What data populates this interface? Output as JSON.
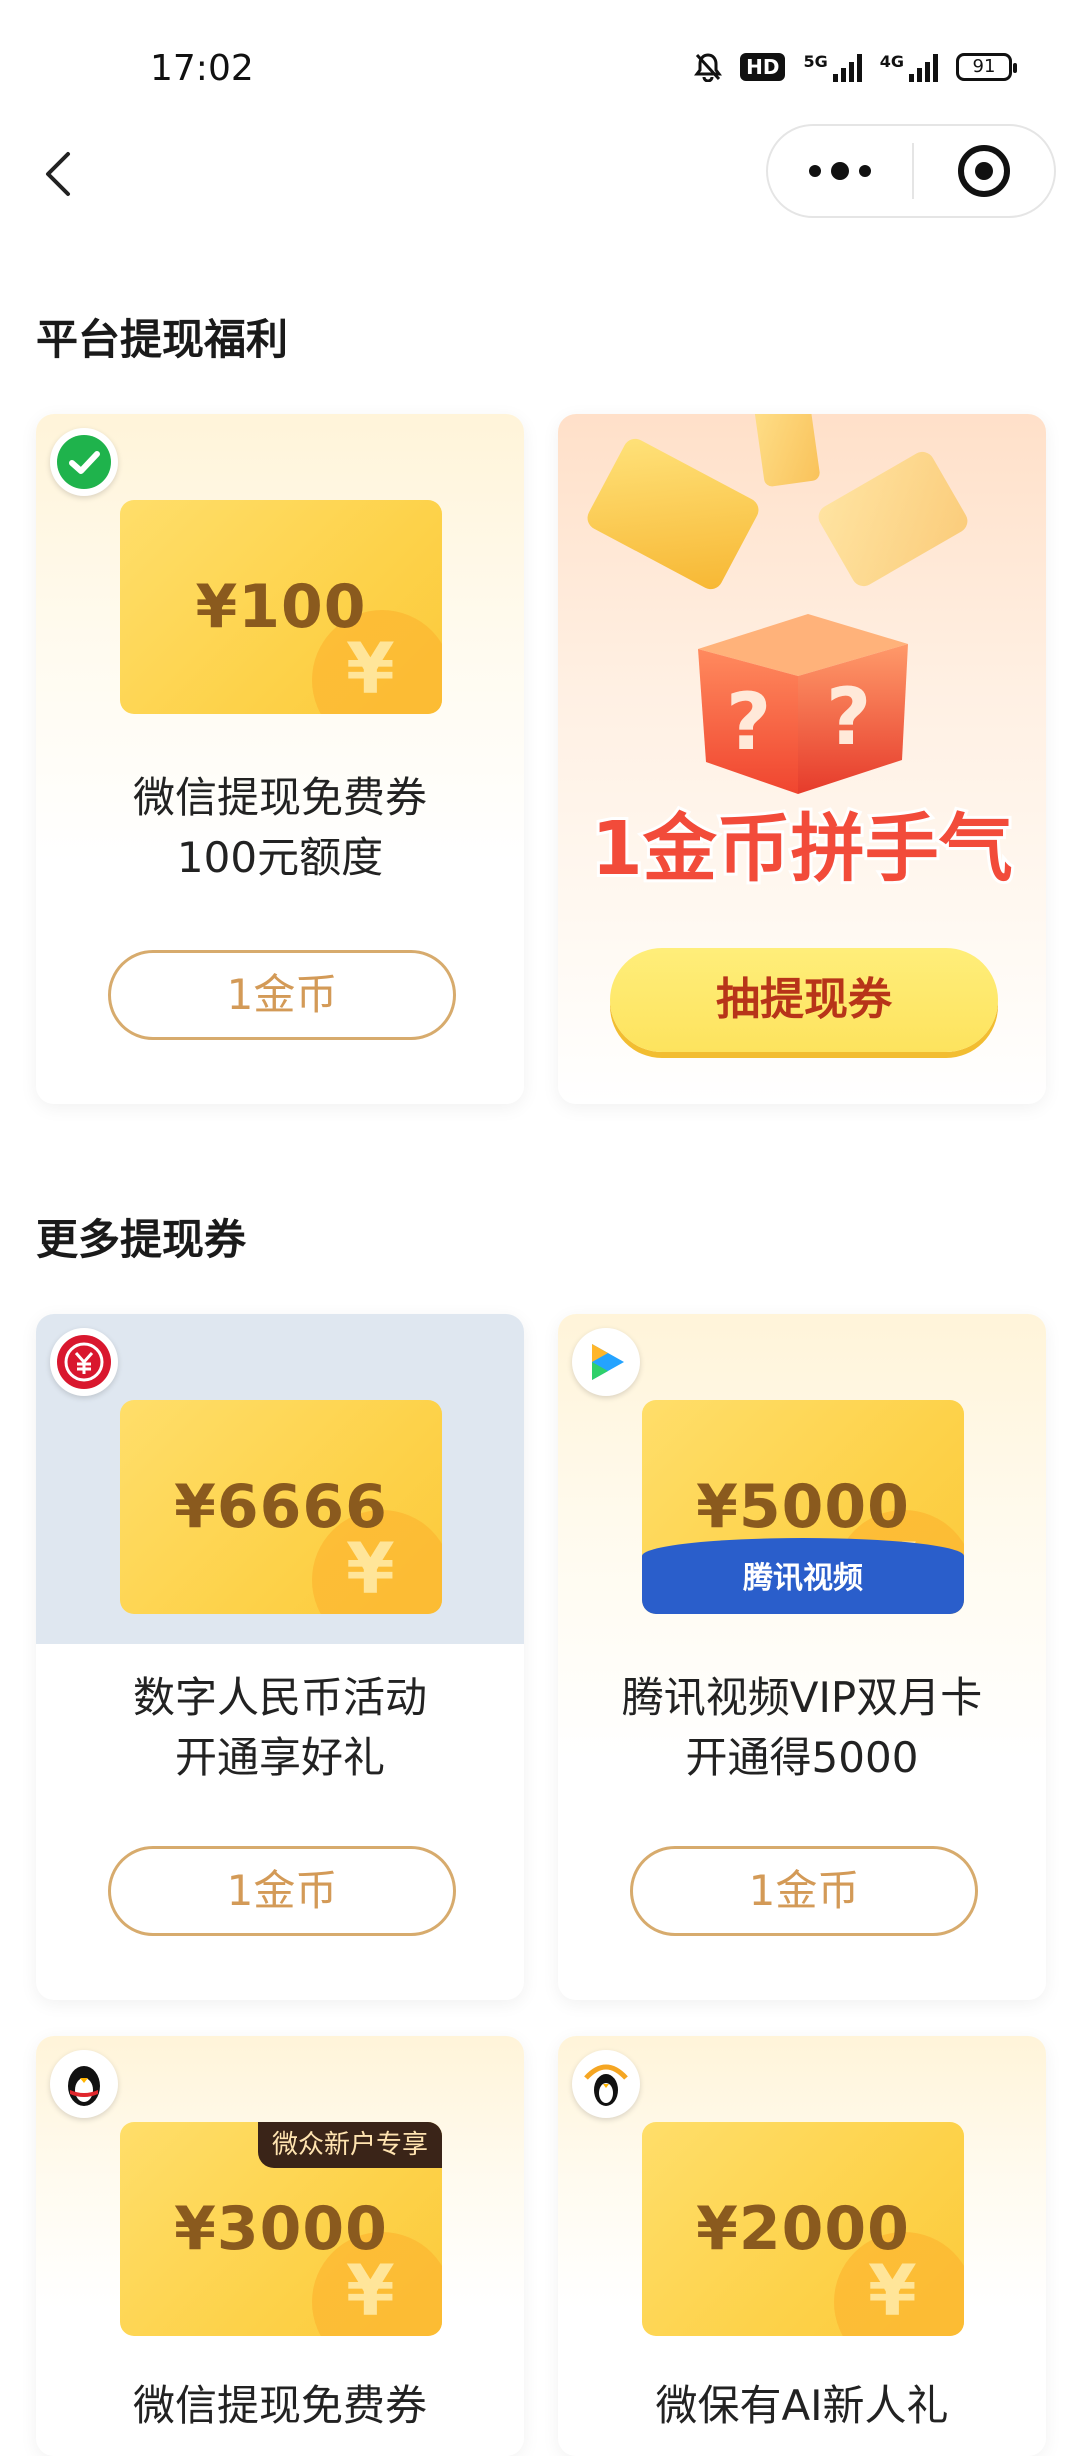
{
  "status_bar": {
    "time": "17:02",
    "hd": "HD",
    "net1": "5G",
    "net2": "4G",
    "battery": "91"
  },
  "nav": {
    "back_icon": "chevron-left-icon",
    "more_icon": "more-dots-icon",
    "close_icon": "target-icon"
  },
  "sections": {
    "platform_title": "平台提现福利",
    "more_title": "更多提现券"
  },
  "cards": {
    "wechat": {
      "icon": "wechat-icon",
      "amount": "¥100",
      "title_line1": "微信提现免费券",
      "title_line2": "100元额度",
      "button": "1金币"
    },
    "lucky": {
      "promo_text": "1金币拼手气",
      "button": "抽提现券"
    },
    "digital_rmb": {
      "icon": "digital-rmb-icon",
      "amount": "¥6666",
      "title_line1": "数字人民币活动",
      "title_line2": "开通享好礼",
      "button": "1金币"
    },
    "tencent_video": {
      "icon": "tencent-video-icon",
      "amount": "¥5000",
      "band": "腾讯视频",
      "title_line1": "腾讯视频VIP双月卡",
      "title_line2": "开通得5000",
      "button": "1金币"
    },
    "webank": {
      "icon": "penguin-icon",
      "amount": "¥3000",
      "tag": "微众新户专享",
      "title_line1": "微信提现免费券"
    },
    "weibao": {
      "icon": "penguin-umbrella-icon",
      "amount": "¥2000",
      "title_line1": "微保有AI新人礼"
    }
  },
  "colors": {
    "coin_button_border": "#d7ab6d",
    "coin_button_text": "#d39a57",
    "draw_button_bg": "#fde35e",
    "draw_button_text": "#b73419",
    "coupon_amount": "#8a5a1e"
  }
}
